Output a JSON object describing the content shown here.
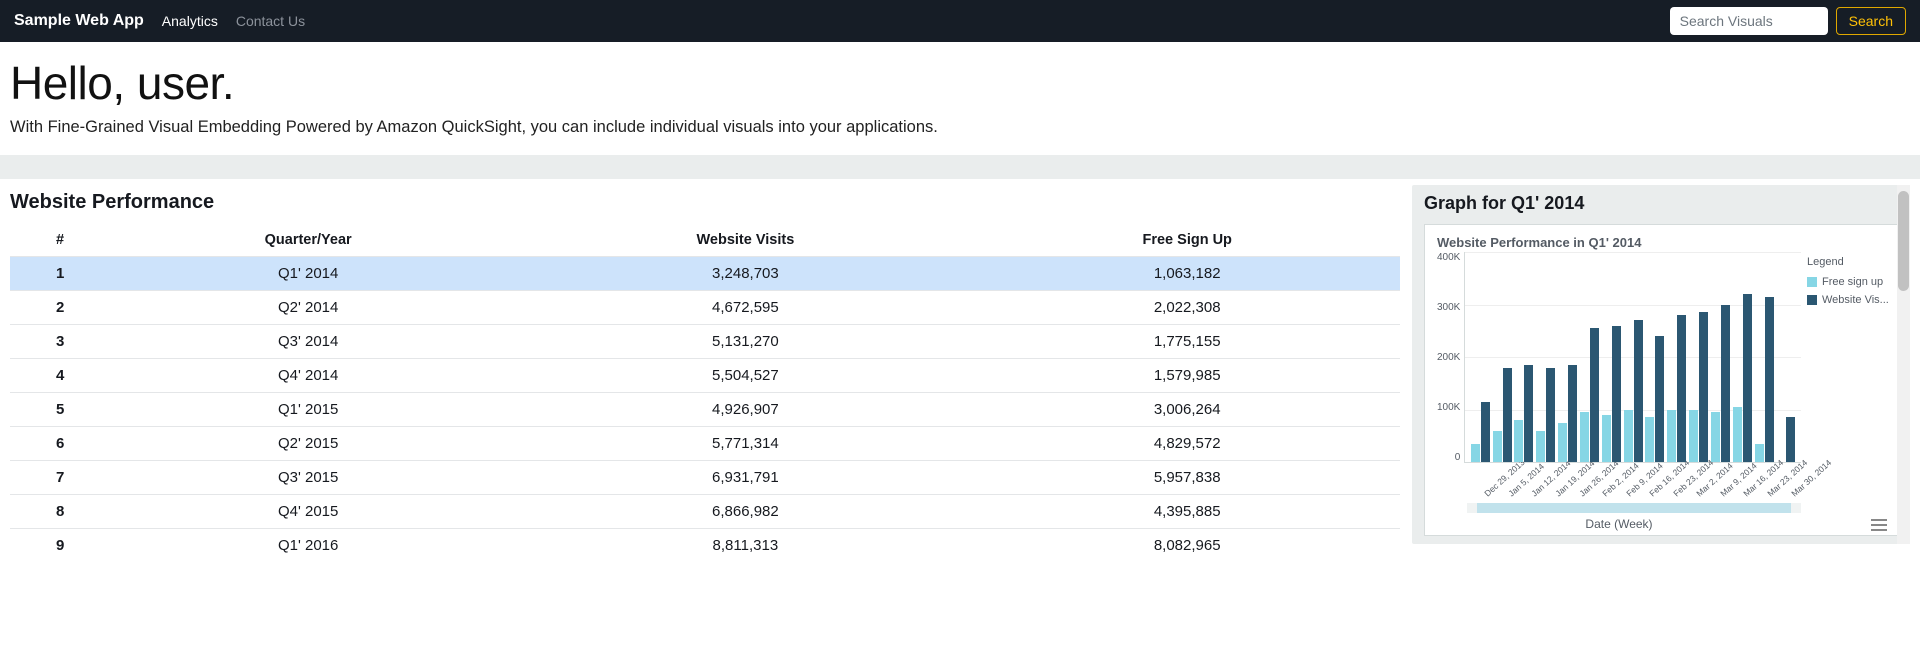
{
  "navbar": {
    "brand": "Sample Web App",
    "link_analytics": "Analytics",
    "link_contact": "Contact Us",
    "search_placeholder": "Search Visuals",
    "search_button": "Search"
  },
  "header": {
    "title": "Hello, user.",
    "subtitle": "With Fine-Grained Visual Embedding Powered by Amazon QuickSight, you can include individual visuals into your applications."
  },
  "table": {
    "heading": "Website Performance",
    "columns": {
      "idx": "#",
      "quarter": "Quarter/Year",
      "visits": "Website Visits",
      "signup": "Free Sign Up"
    },
    "rows": [
      {
        "idx": "1",
        "quarter": "Q1' 2014",
        "visits": "3,248,703",
        "signup": "1,063,182",
        "selected": true
      },
      {
        "idx": "2",
        "quarter": "Q2' 2014",
        "visits": "4,672,595",
        "signup": "2,022,308"
      },
      {
        "idx": "3",
        "quarter": "Q3' 2014",
        "visits": "5,131,270",
        "signup": "1,775,155"
      },
      {
        "idx": "4",
        "quarter": "Q4' 2014",
        "visits": "5,504,527",
        "signup": "1,579,985"
      },
      {
        "idx": "5",
        "quarter": "Q1' 2015",
        "visits": "4,926,907",
        "signup": "3,006,264"
      },
      {
        "idx": "6",
        "quarter": "Q2' 2015",
        "visits": "5,771,314",
        "signup": "4,829,572"
      },
      {
        "idx": "7",
        "quarter": "Q3' 2015",
        "visits": "6,931,791",
        "signup": "5,957,838"
      },
      {
        "idx": "8",
        "quarter": "Q4' 2015",
        "visits": "6,866,982",
        "signup": "4,395,885"
      },
      {
        "idx": "9",
        "quarter": "Q1' 2016",
        "visits": "8,811,313",
        "signup": "8,082,965"
      }
    ]
  },
  "graph": {
    "heading": "Graph for Q1' 2014",
    "chart_title": "Website Performance in Q1' 2014",
    "legend_title": "Legend",
    "legend_free": "Free sign up",
    "legend_visits": "Website Vis...",
    "x_title": "Date (Week)"
  },
  "chart_data": {
    "type": "bar",
    "title": "Website Performance in Q1' 2014",
    "xlabel": "Date (Week)",
    "ylabel": "",
    "ylim": [
      0,
      400000
    ],
    "y_ticks": [
      "400K",
      "300K",
      "200K",
      "100K",
      "0"
    ],
    "categories": [
      "Dec 29, 2013",
      "Jan 5, 2014",
      "Jan 12, 2014",
      "Jan 19, 2014",
      "Jan 26, 2014",
      "Feb 2, 2014",
      "Feb 9, 2014",
      "Feb 16, 2014",
      "Feb 23, 2014",
      "Mar 2, 2014",
      "Mar 9, 2014",
      "Mar 16, 2014",
      "Mar 23, 2014",
      "Mar 30, 2014"
    ],
    "series": [
      {
        "name": "Free sign up",
        "color": "#86d6e5",
        "values": [
          35000,
          60000,
          80000,
          60000,
          75000,
          95000,
          90000,
          100000,
          85000,
          100000,
          100000,
          95000,
          105000,
          35000
        ]
      },
      {
        "name": "Website Visits",
        "color": "#2b5772",
        "values": [
          115000,
          180000,
          185000,
          180000,
          185000,
          255000,
          260000,
          270000,
          240000,
          280000,
          285000,
          300000,
          320000,
          315000,
          85000
        ]
      }
    ],
    "colors": {
      "free_sign_up": "#86d6e5",
      "website_visits": "#2b5772"
    }
  }
}
